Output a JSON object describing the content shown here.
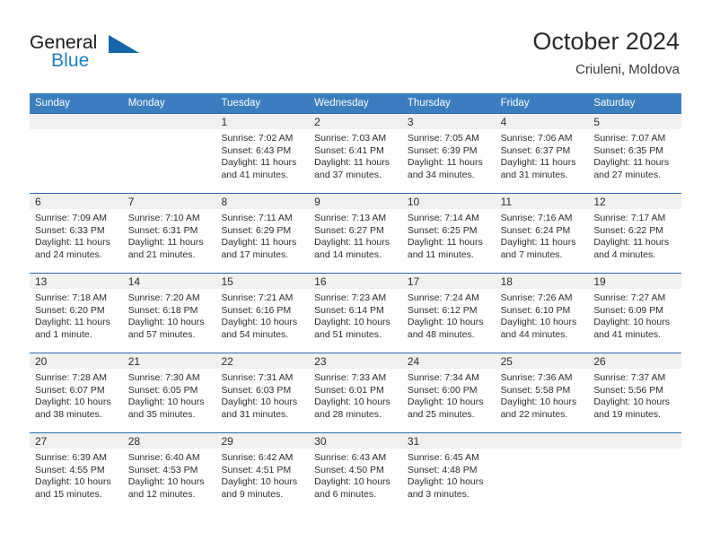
{
  "brand": {
    "word1": "General",
    "word2": "Blue",
    "triangle_color": "#1565a8",
    "blue_color": "#1f7fc4"
  },
  "header": {
    "title": "October 2024",
    "subtitle": "Criuleni, Moldova"
  },
  "theme": {
    "header_blue": "#3a7ebf",
    "separator_blue": "#2a6aa8",
    "band_gray": "#f0f0f0"
  },
  "weekdays": [
    "Sunday",
    "Monday",
    "Tuesday",
    "Wednesday",
    "Thursday",
    "Friday",
    "Saturday"
  ],
  "weeks": [
    [
      {
        "day": "",
        "sunrise": "",
        "sunset": "",
        "daylight": ""
      },
      {
        "day": "",
        "sunrise": "",
        "sunset": "",
        "daylight": ""
      },
      {
        "day": "1",
        "sunrise": "Sunrise: 7:02 AM",
        "sunset": "Sunset: 6:43 PM",
        "daylight": "Daylight: 11 hours and 41 minutes."
      },
      {
        "day": "2",
        "sunrise": "Sunrise: 7:03 AM",
        "sunset": "Sunset: 6:41 PM",
        "daylight": "Daylight: 11 hours and 37 minutes."
      },
      {
        "day": "3",
        "sunrise": "Sunrise: 7:05 AM",
        "sunset": "Sunset: 6:39 PM",
        "daylight": "Daylight: 11 hours and 34 minutes."
      },
      {
        "day": "4",
        "sunrise": "Sunrise: 7:06 AM",
        "sunset": "Sunset: 6:37 PM",
        "daylight": "Daylight: 11 hours and 31 minutes."
      },
      {
        "day": "5",
        "sunrise": "Sunrise: 7:07 AM",
        "sunset": "Sunset: 6:35 PM",
        "daylight": "Daylight: 11 hours and 27 minutes."
      }
    ],
    [
      {
        "day": "6",
        "sunrise": "Sunrise: 7:09 AM",
        "sunset": "Sunset: 6:33 PM",
        "daylight": "Daylight: 11 hours and 24 minutes."
      },
      {
        "day": "7",
        "sunrise": "Sunrise: 7:10 AM",
        "sunset": "Sunset: 6:31 PM",
        "daylight": "Daylight: 11 hours and 21 minutes."
      },
      {
        "day": "8",
        "sunrise": "Sunrise: 7:11 AM",
        "sunset": "Sunset: 6:29 PM",
        "daylight": "Daylight: 11 hours and 17 minutes."
      },
      {
        "day": "9",
        "sunrise": "Sunrise: 7:13 AM",
        "sunset": "Sunset: 6:27 PM",
        "daylight": "Daylight: 11 hours and 14 minutes."
      },
      {
        "day": "10",
        "sunrise": "Sunrise: 7:14 AM",
        "sunset": "Sunset: 6:25 PM",
        "daylight": "Daylight: 11 hours and 11 minutes."
      },
      {
        "day": "11",
        "sunrise": "Sunrise: 7:16 AM",
        "sunset": "Sunset: 6:24 PM",
        "daylight": "Daylight: 11 hours and 7 minutes."
      },
      {
        "day": "12",
        "sunrise": "Sunrise: 7:17 AM",
        "sunset": "Sunset: 6:22 PM",
        "daylight": "Daylight: 11 hours and 4 minutes."
      }
    ],
    [
      {
        "day": "13",
        "sunrise": "Sunrise: 7:18 AM",
        "sunset": "Sunset: 6:20 PM",
        "daylight": "Daylight: 11 hours and 1 minute."
      },
      {
        "day": "14",
        "sunrise": "Sunrise: 7:20 AM",
        "sunset": "Sunset: 6:18 PM",
        "daylight": "Daylight: 10 hours and 57 minutes."
      },
      {
        "day": "15",
        "sunrise": "Sunrise: 7:21 AM",
        "sunset": "Sunset: 6:16 PM",
        "daylight": "Daylight: 10 hours and 54 minutes."
      },
      {
        "day": "16",
        "sunrise": "Sunrise: 7:23 AM",
        "sunset": "Sunset: 6:14 PM",
        "daylight": "Daylight: 10 hours and 51 minutes."
      },
      {
        "day": "17",
        "sunrise": "Sunrise: 7:24 AM",
        "sunset": "Sunset: 6:12 PM",
        "daylight": "Daylight: 10 hours and 48 minutes."
      },
      {
        "day": "18",
        "sunrise": "Sunrise: 7:26 AM",
        "sunset": "Sunset: 6:10 PM",
        "daylight": "Daylight: 10 hours and 44 minutes."
      },
      {
        "day": "19",
        "sunrise": "Sunrise: 7:27 AM",
        "sunset": "Sunset: 6:09 PM",
        "daylight": "Daylight: 10 hours and 41 minutes."
      }
    ],
    [
      {
        "day": "20",
        "sunrise": "Sunrise: 7:28 AM",
        "sunset": "Sunset: 6:07 PM",
        "daylight": "Daylight: 10 hours and 38 minutes."
      },
      {
        "day": "21",
        "sunrise": "Sunrise: 7:30 AM",
        "sunset": "Sunset: 6:05 PM",
        "daylight": "Daylight: 10 hours and 35 minutes."
      },
      {
        "day": "22",
        "sunrise": "Sunrise: 7:31 AM",
        "sunset": "Sunset: 6:03 PM",
        "daylight": "Daylight: 10 hours and 31 minutes."
      },
      {
        "day": "23",
        "sunrise": "Sunrise: 7:33 AM",
        "sunset": "Sunset: 6:01 PM",
        "daylight": "Daylight: 10 hours and 28 minutes."
      },
      {
        "day": "24",
        "sunrise": "Sunrise: 7:34 AM",
        "sunset": "Sunset: 6:00 PM",
        "daylight": "Daylight: 10 hours and 25 minutes."
      },
      {
        "day": "25",
        "sunrise": "Sunrise: 7:36 AM",
        "sunset": "Sunset: 5:58 PM",
        "daylight": "Daylight: 10 hours and 22 minutes."
      },
      {
        "day": "26",
        "sunrise": "Sunrise: 7:37 AM",
        "sunset": "Sunset: 5:56 PM",
        "daylight": "Daylight: 10 hours and 19 minutes."
      }
    ],
    [
      {
        "day": "27",
        "sunrise": "Sunrise: 6:39 AM",
        "sunset": "Sunset: 4:55 PM",
        "daylight": "Daylight: 10 hours and 15 minutes."
      },
      {
        "day": "28",
        "sunrise": "Sunrise: 6:40 AM",
        "sunset": "Sunset: 4:53 PM",
        "daylight": "Daylight: 10 hours and 12 minutes."
      },
      {
        "day": "29",
        "sunrise": "Sunrise: 6:42 AM",
        "sunset": "Sunset: 4:51 PM",
        "daylight": "Daylight: 10 hours and 9 minutes."
      },
      {
        "day": "30",
        "sunrise": "Sunrise: 6:43 AM",
        "sunset": "Sunset: 4:50 PM",
        "daylight": "Daylight: 10 hours and 6 minutes."
      },
      {
        "day": "31",
        "sunrise": "Sunrise: 6:45 AM",
        "sunset": "Sunset: 4:48 PM",
        "daylight": "Daylight: 10 hours and 3 minutes."
      },
      {
        "day": "",
        "sunrise": "",
        "sunset": "",
        "daylight": ""
      },
      {
        "day": "",
        "sunrise": "",
        "sunset": "",
        "daylight": ""
      }
    ]
  ]
}
